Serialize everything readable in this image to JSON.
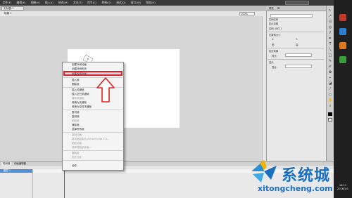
{
  "menubar": {
    "items": [
      "文件(F)",
      "编辑(E)",
      "视图(V)",
      "插入(I)",
      "修改(M)",
      "文本(T)",
      "命令(C)",
      "控制(O)",
      "调试(D)",
      "窗口(W)",
      "帮助(H)"
    ]
  },
  "document": {
    "tab": "无标题-1",
    "scene": "场景 1",
    "zoom": "100%"
  },
  "properties": {
    "tabs": [
      "属性",
      "库"
    ],
    "rows": [
      "实例名称",
      "影片剪辑",
      "实例: 元件 1",
      "位置和大小",
      "X:",
      "Y:",
      "宽:",
      "高:",
      "色彩效果",
      "样式:",
      "显示",
      "混合:"
    ]
  },
  "context_menu": {
    "items": [
      {
        "label": "创建补间动画",
        "disabled": false
      },
      {
        "label": "创建补间形状",
        "disabled": false
      },
      {
        "label": "创建传统补间",
        "disabled": false,
        "highlighted": true
      },
      {
        "label": "插入帧",
        "disabled": false
      },
      {
        "label": "删除帧",
        "disabled": false
      },
      {
        "label": "插入关键帧",
        "disabled": false
      },
      {
        "label": "插入空白关键帧",
        "disabled": false
      },
      {
        "label": "清除关键帧",
        "disabled": true
      },
      {
        "label": "转换为关键帧",
        "disabled": false
      },
      {
        "label": "转换为空白关键帧",
        "disabled": false
      },
      {
        "label": "剪切帧",
        "disabled": false
      },
      {
        "label": "复制帧",
        "disabled": false
      },
      {
        "label": "粘贴帧",
        "disabled": true
      },
      {
        "label": "清除帧",
        "disabled": false
      },
      {
        "label": "选择所有帧",
        "disabled": false
      },
      {
        "label": "复制动画",
        "disabled": true
      },
      {
        "label": "将动画复制为 ActionScript 3.0...",
        "disabled": true
      },
      {
        "label": "粘贴动画",
        "disabled": true
      },
      {
        "label": "选择性粘贴动画...",
        "disabled": true
      },
      {
        "label": "翻转帧",
        "disabled": true
      },
      {
        "label": "同步元件",
        "disabled": true
      },
      {
        "label": "动作",
        "disabled": false
      }
    ]
  },
  "timeline": {
    "tabs": [
      "时间轴",
      "动画编辑器"
    ],
    "layer": "图层 1"
  },
  "clock": {
    "time": "16:11",
    "date": "2016/1/1"
  },
  "watermark": {
    "brand": "系统城",
    "url": "xitongcheng.com"
  },
  "colors": {
    "highlight_border": "#e02020",
    "menu_highlight": "#c5d9f1",
    "watermark": "#1a6fc0"
  }
}
